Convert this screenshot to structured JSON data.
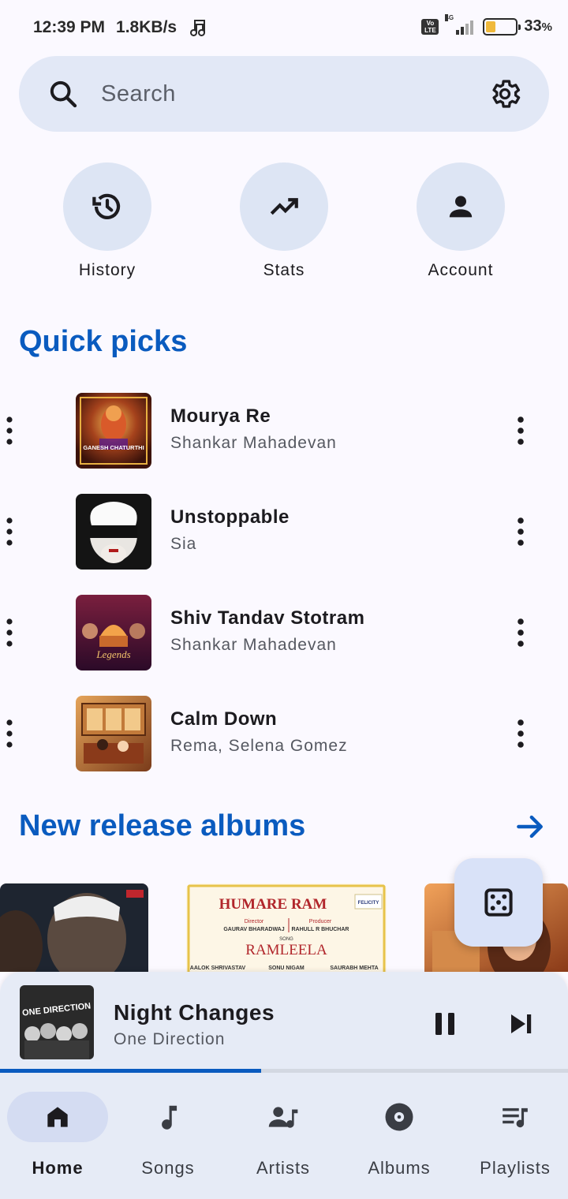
{
  "status_bar": {
    "time": "12:39 PM",
    "speed": "1.8KB/s",
    "network": "4G",
    "volte": "Vo\nLTE",
    "battery": "33",
    "battery_unit": "%"
  },
  "search": {
    "placeholder": "Search"
  },
  "shortcuts": [
    {
      "label": "History",
      "icon": "history-icon"
    },
    {
      "label": "Stats",
      "icon": "trending-up-icon"
    },
    {
      "label": "Account",
      "icon": "person-icon"
    }
  ],
  "quick_picks": {
    "title": "Quick picks",
    "songs": [
      {
        "title": "Mourya Re",
        "artist": "Shankar Mahadevan"
      },
      {
        "title": "Unstoppable",
        "artist": "Sia"
      },
      {
        "title": "Shiv Tandav Stotram",
        "artist": "Shankar Mahadevan"
      },
      {
        "title": "Calm Down",
        "artist": "Rema, Selena Gomez"
      }
    ]
  },
  "album_art_text": {
    "ganesh": "GANESH CHATURTHI",
    "legends": "Legends",
    "one_direction": "ONE DIRECTION"
  },
  "new_releases": {
    "title": "New release albums",
    "humare_ram": {
      "title": "HUMARE RAM",
      "director_role": "Director",
      "director": "GAURAV BHARADWAJ",
      "producer_role": "Producer",
      "producer": "RAHULL R BHUCHAR",
      "song_label": "SONG",
      "song": "RAMLEELA",
      "credits": [
        "AALOK SHRIVASTAV",
        "SONU NIGAM",
        "SAURABH MEHTA"
      ],
      "badge": "FELICITY"
    }
  },
  "now_playing": {
    "title": "Night Changes",
    "artist": "One Direction",
    "progress": 0.46
  },
  "nav": {
    "items": [
      {
        "label": "Home",
        "icon": "home-icon",
        "active": true
      },
      {
        "label": "Songs",
        "icon": "music-note-icon",
        "active": false
      },
      {
        "label": "Artists",
        "icon": "artist-icon",
        "active": false
      },
      {
        "label": "Albums",
        "icon": "album-icon",
        "active": false
      },
      {
        "label": "Playlists",
        "icon": "playlist-icon",
        "active": false
      }
    ]
  },
  "colors": {
    "accent": "#0a5bbf",
    "background": "#fbf9ff",
    "surface": "#e2e8f6"
  }
}
